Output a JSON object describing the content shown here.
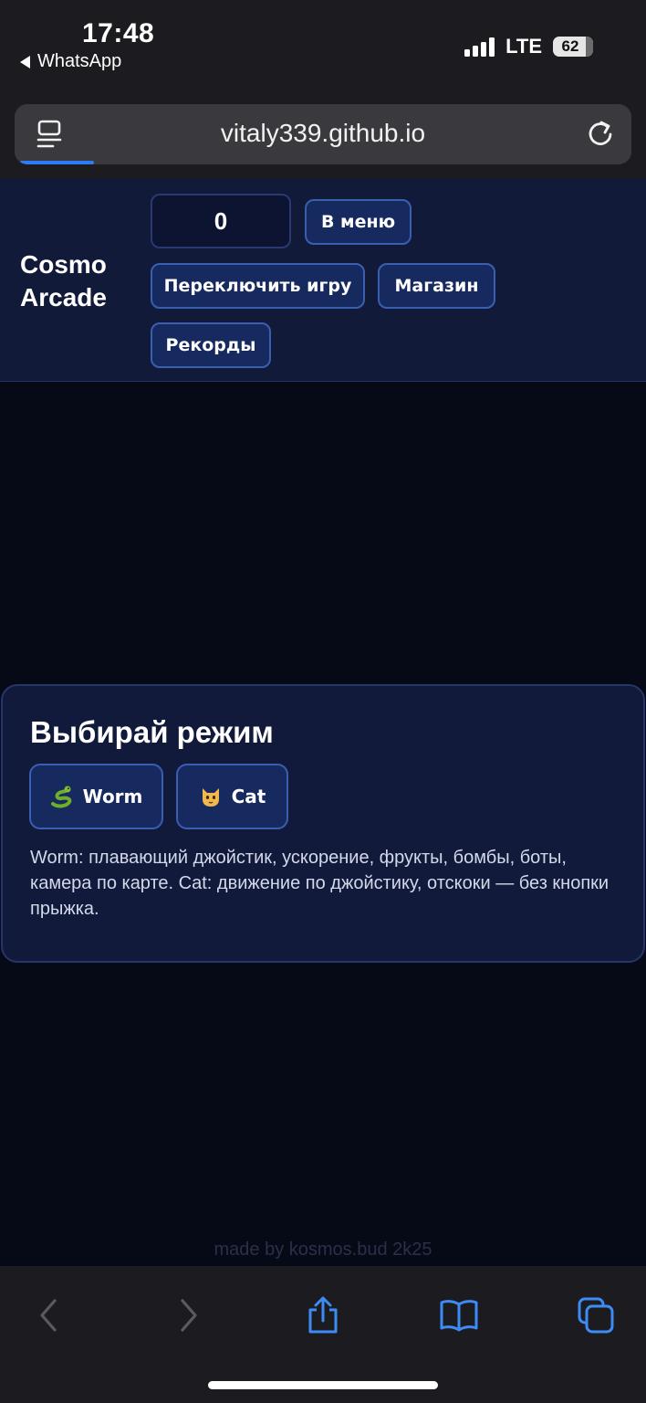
{
  "status_bar": {
    "time": "17:48",
    "back_app": "WhatsApp",
    "network": "LTE",
    "battery": "62"
  },
  "browser": {
    "url": "vitaly339.github.io",
    "load_progress": 0.12
  },
  "header": {
    "brand_line1": "Cosmo",
    "brand_line2": "Arcade",
    "score": "0",
    "menu_button": "В меню",
    "switch_game_button": "Переключить игру",
    "shop_button": "Магазин",
    "records_button": "Рекорды"
  },
  "mode_panel": {
    "title": "Выбирай режим",
    "modes": [
      {
        "label": "Worm",
        "icon": "snake-emoji"
      },
      {
        "label": "Cat",
        "icon": "cat-emoji"
      }
    ],
    "description": "Worm: плавающий джойстик, ускорение, фрукты, бомбы, боты, камера по карте. Cat: движение по джойстику, отскоки — без кнопки прыжка."
  },
  "footer": {
    "credit": "made by kosmos.bud 2k25"
  },
  "toolbar": {
    "icons": [
      "back-icon",
      "forward-icon",
      "share-icon",
      "bookmarks-icon",
      "tabs-icon"
    ]
  },
  "colors": {
    "page_bg": "#060a17",
    "header_bg": "#121a3a",
    "button_bg": "#172a60",
    "button_border": "#3a5fb0",
    "accent": "#2f7bf5",
    "chrome_bg": "#1c1c20"
  }
}
